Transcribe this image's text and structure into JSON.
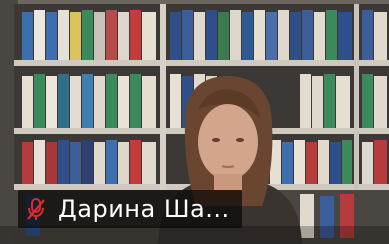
{
  "participant": {
    "display_name": "Дарина Ша...",
    "mic_status": "muted",
    "mic_icon": "mic-muted-icon"
  },
  "colors": {
    "muted_icon": "#e02828",
    "name_overlay_bg": "#000000",
    "name_text": "#ffffff"
  }
}
